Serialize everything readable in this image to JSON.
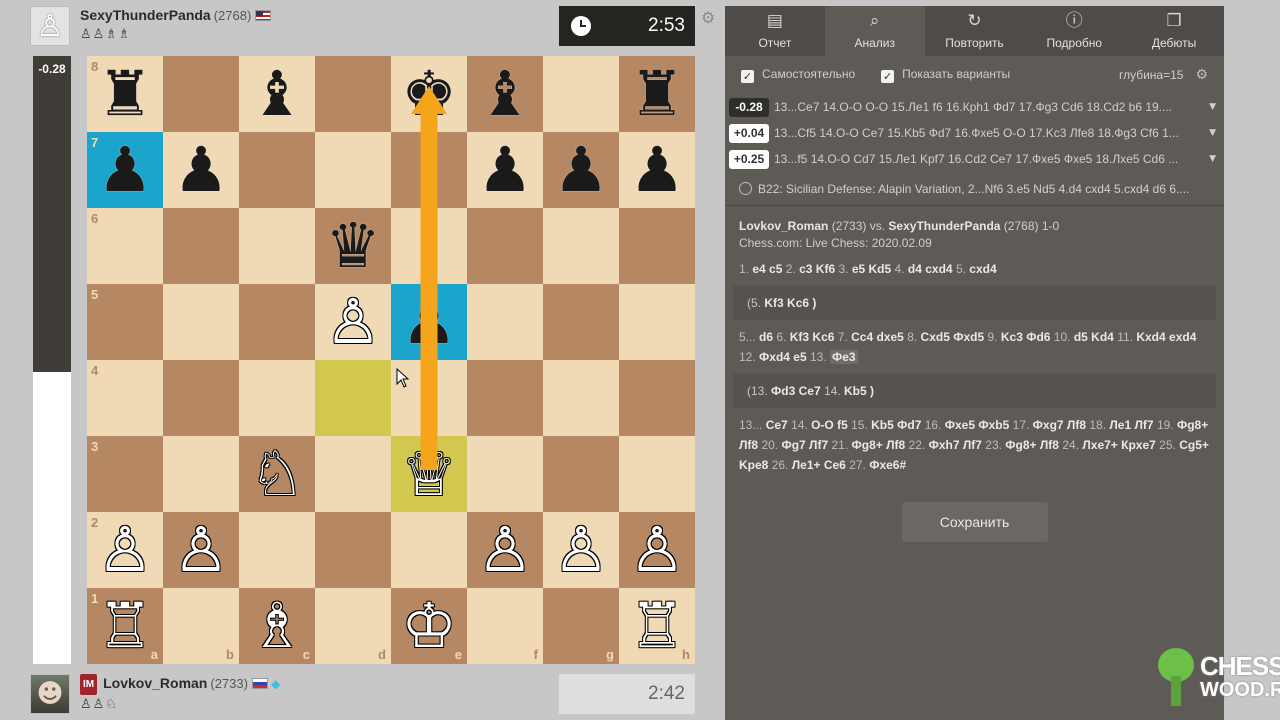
{
  "top_player": {
    "name": "SexyThunderPanda",
    "rating": "(2768)",
    "captured": "♙♙♗♗"
  },
  "bottom_player": {
    "title": "IM",
    "name": "Lovkov_Roman",
    "rating": "(2733)",
    "captured": "♙♙♘"
  },
  "clocks": {
    "top": "2:53",
    "bottom": "2:42"
  },
  "eval_bar": {
    "label": "-0.28",
    "black_share": 0.52
  },
  "board": {
    "ranks": [
      "8",
      "7",
      "6",
      "5",
      "4",
      "3",
      "2",
      "1"
    ],
    "files": [
      "a",
      "b",
      "c",
      "d",
      "e",
      "f",
      "g",
      "h"
    ],
    "rows": [
      [
        {
          "p": "♜",
          "c": "b"
        },
        {},
        {
          "p": "♝",
          "c": "b"
        },
        {},
        {
          "p": "♚",
          "c": "b"
        },
        {
          "p": "♝",
          "c": "b"
        },
        {},
        {
          "p": "♜",
          "c": "b"
        }
      ],
      [
        {
          "p": "♟",
          "c": "b",
          "hl": "blue"
        },
        {
          "p": "♟",
          "c": "b"
        },
        {},
        {},
        {},
        {
          "p": "♟",
          "c": "b"
        },
        {
          "p": "♟",
          "c": "b"
        },
        {
          "p": "♟",
          "c": "b"
        }
      ],
      [
        {},
        {},
        {},
        {
          "p": "♛",
          "c": "b"
        },
        {},
        {},
        {},
        {}
      ],
      [
        {},
        {},
        {},
        {
          "p": "♙",
          "c": "w"
        },
        {
          "p": "♟",
          "c": "b",
          "hl": "blue"
        },
        {},
        {},
        {}
      ],
      [
        {},
        {},
        {},
        {
          "hl": "yellow"
        },
        {},
        {},
        {},
        {}
      ],
      [
        {},
        {},
        {
          "p": "♘",
          "c": "w"
        },
        {},
        {
          "p": "♕",
          "c": "w",
          "hl": "yellow"
        },
        {},
        {},
        {}
      ],
      [
        {
          "p": "♙",
          "c": "w"
        },
        {
          "p": "♙",
          "c": "w"
        },
        {},
        {},
        {},
        {
          "p": "♙",
          "c": "w"
        },
        {
          "p": "♙",
          "c": "w"
        },
        {
          "p": "♙",
          "c": "w"
        }
      ],
      [
        {
          "p": "♖",
          "c": "w"
        },
        {},
        {
          "p": "♗",
          "c": "w"
        },
        {},
        {
          "p": "♔",
          "c": "w"
        },
        {},
        {},
        {
          "p": "♖",
          "c": "w"
        }
      ]
    ],
    "arrow": {
      "from": "e3",
      "to": "e8",
      "color": "#f5a51c"
    }
  },
  "tabs": [
    {
      "label": "Отчет",
      "icon": "report-icon",
      "glyph": "▤"
    },
    {
      "label": "Анализ",
      "icon": "analysis-icon",
      "glyph": "⌕",
      "active": true
    },
    {
      "label": "Повторить",
      "icon": "retry-icon",
      "glyph": "↻"
    },
    {
      "label": "Подробно",
      "icon": "info-icon",
      "glyph": "ⓘ"
    },
    {
      "label": "Дебюты",
      "icon": "openings-icon",
      "glyph": "❒"
    }
  ],
  "options": {
    "self_label": "Самостоятельно",
    "variants_label": "Показать варианты",
    "depth": "глубина=15"
  },
  "engine_lines": [
    {
      "score": "-0.28",
      "sign": "neg",
      "text": "13...Ce7 14.O-O O-O 15.Ле1 f6 16.Крh1 Фd7 17.Фg3 Cd6 18.Cd2 b6 19...."
    },
    {
      "score": "+0.04",
      "sign": "pos",
      "text": "13...Cf5 14.O-O Ce7 15.Kb5 Фd7 16.Фxe5 O-O 17.Kc3 Лfe8 18.Фg3 Cf6 1..."
    },
    {
      "score": "+0.25",
      "sign": "pos",
      "text": "13...f5 14.O-O Cd7 15.Ле1 Kpf7 16.Cd2 Ce7 17.Фxe5 Фxe5 18.Лxe5 Cd6 ..."
    }
  ],
  "opening": "B22: Sicilian Defense: Alapin Variation, 2...Nf6 3.e5 Nd5 4.d4 cxd4 5.cxd4 d6 6....",
  "game": {
    "white": "Lovkov_Roman",
    "white_rating": "(2733)",
    "vs": "vs.",
    "black": "SexyThunderPanda",
    "black_rating": "(2768)",
    "result": "1-0",
    "event": "Chess.com: Live Chess: 2020.02.09"
  },
  "moves": {
    "line1": [
      [
        "1.",
        "e4 c5"
      ],
      [
        "2.",
        "c3 Kf6"
      ],
      [
        "3.",
        "e5 Kd5"
      ],
      [
        "4.",
        "d4 cxd4"
      ],
      [
        "5.",
        "cxd4"
      ]
    ],
    "var1": [
      [
        "(5.",
        "Kf3 Kc6"
      ],
      [
        "",
        ")"
      ]
    ],
    "line2": [
      [
        "5...",
        "d6"
      ],
      [
        "6.",
        "Kf3 Kc6"
      ],
      [
        "7.",
        "Cc4 dxe5"
      ],
      [
        "8.",
        "Cxd5 Фxd5"
      ],
      [
        "9.",
        "Kc3 Фd6"
      ],
      [
        "10.",
        "d5 Kd4"
      ],
      [
        "11.",
        "Kxd4"
      ],
      [
        "",
        "exd4"
      ],
      [
        "12.",
        "Фxd4 e5"
      ],
      [
        "13.",
        ""
      ]
    ],
    "current_move": "Фe3",
    "var2": [
      [
        "(13.",
        "Фd3 Ce7"
      ],
      [
        "14.",
        "Kb5"
      ],
      [
        "",
        ")"
      ]
    ],
    "line3": [
      [
        "13...",
        "Ce7"
      ],
      [
        "14.",
        "O-O f5"
      ],
      [
        "15.",
        "Kb5 Фd7"
      ],
      [
        "16.",
        "Фxe5 Фxb5"
      ],
      [
        "17.",
        "Фxg7 Лf8"
      ],
      [
        "18.",
        "Ле1 Лf7"
      ],
      [
        "19.",
        "Фg8+ Лf8"
      ],
      [
        "20.",
        "Фg7 Лf7"
      ],
      [
        "21.",
        "Фg8+ Лf8"
      ],
      [
        "22.",
        "Фxh7 Лf7"
      ],
      [
        "23.",
        "Фg8+ Лf8"
      ],
      [
        "24.",
        "Лxe7+ Крxe7"
      ],
      [
        "25.",
        "Cg5+ Kpe8"
      ],
      [
        "26.",
        "Ле1+ Ce6"
      ],
      [
        "27.",
        "Фxe6#"
      ]
    ]
  },
  "save_label": "Сохранить",
  "watermark": {
    "line1": "CHESS",
    "line2": "WOOD.RU"
  }
}
